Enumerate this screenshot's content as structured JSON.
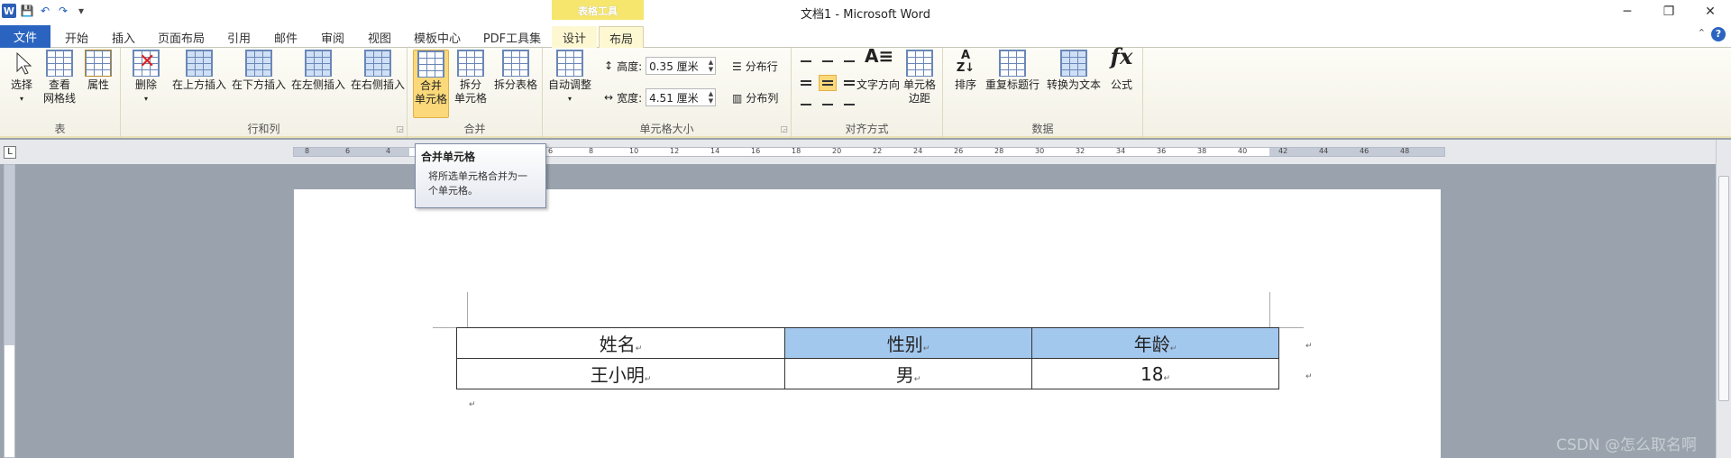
{
  "titlebar": {
    "title": "文档1 - Microsoft Word",
    "context_tab": "表格工具",
    "minimize": "─",
    "restore": "❐",
    "close": "✕"
  },
  "qat": {
    "word": "W",
    "save": "💾",
    "undo": "↶",
    "redo": "↷",
    "more": "▾"
  },
  "tabs": [
    {
      "label": "文件"
    },
    {
      "label": "开始"
    },
    {
      "label": "插入"
    },
    {
      "label": "页面布局"
    },
    {
      "label": "引用"
    },
    {
      "label": "邮件"
    },
    {
      "label": "审阅"
    },
    {
      "label": "视图"
    },
    {
      "label": "模板中心"
    },
    {
      "label": "PDF工具集"
    },
    {
      "label": "设计"
    },
    {
      "label": "布局"
    }
  ],
  "ribbon": {
    "table_group": {
      "label": "表",
      "select": "选择",
      "gridlines_1": "查看",
      "gridlines_2": "网格线",
      "props": "属性"
    },
    "rowcol_group": {
      "label": "行和列",
      "delete": "删除",
      "above": "在上方插入",
      "below": "在下方插入",
      "left": "在左侧插入",
      "right": "在右侧插入"
    },
    "merge_group": {
      "label": "合并",
      "merge_1": "合并",
      "merge_2": "单元格",
      "split_1": "拆分",
      "split_2": "单元格",
      "split_table": "拆分表格"
    },
    "size_group": {
      "label": "单元格大小",
      "autofit": "自动调整",
      "height_label": "高度:",
      "height_val": "0.35 厘米",
      "width_label": "宽度:",
      "width_val": "4.51 厘米",
      "dist_rows": "分布行",
      "dist_cols": "分布列"
    },
    "align_group": {
      "label": "对齐方式",
      "text_dir": "文字方向",
      "margins_1": "单元格",
      "margins_2": "边距"
    },
    "data_group": {
      "label": "数据",
      "sort": "排序",
      "repeat_header": "重复标题行",
      "to_text": "转换为文本",
      "formula": "公式",
      "fx": "fx"
    }
  },
  "tooltip": {
    "title": "合并单元格",
    "body_1": "将所选单元格合并为一",
    "body_2": "个单元格。"
  },
  "ruler_numbers": [
    "8",
    "6",
    "4",
    "2",
    "2",
    "4",
    "6",
    "8",
    "10",
    "12",
    "14",
    "16",
    "18",
    "20",
    "22",
    "24",
    "26",
    "28",
    "30",
    "32",
    "34",
    "36",
    "38",
    "40",
    "42",
    "44",
    "46",
    "48"
  ],
  "table": {
    "rows": [
      [
        "姓名",
        "性别",
        "年龄"
      ],
      [
        "王小明",
        "男",
        "18"
      ]
    ],
    "cell_mark": "↵"
  },
  "watermark": "CSDN @怎么取名啊"
}
